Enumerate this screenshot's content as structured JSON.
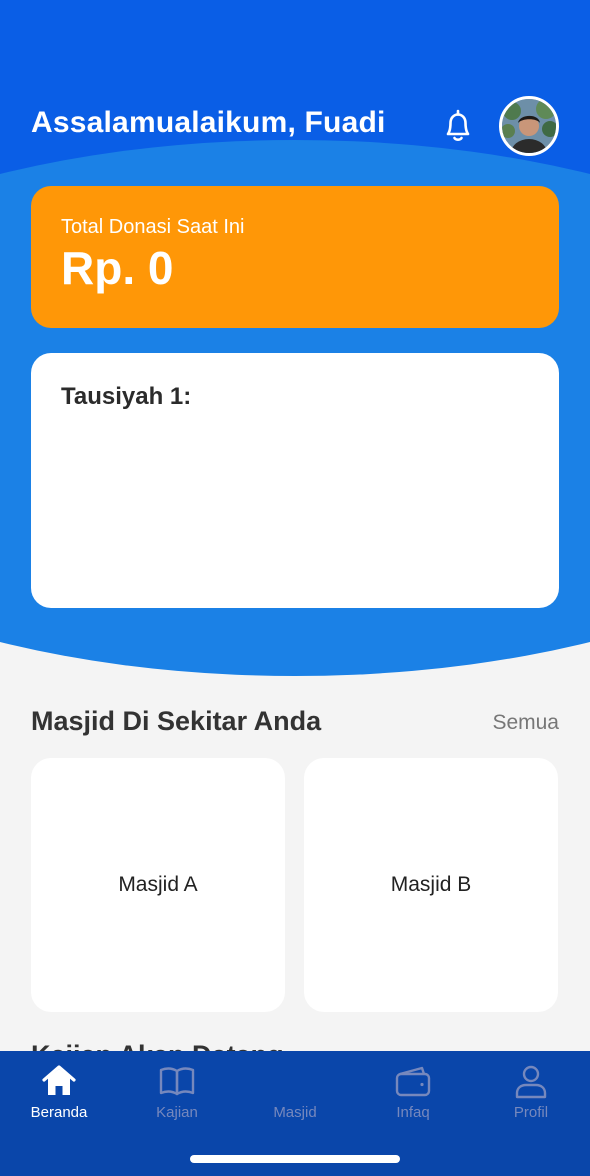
{
  "header": {
    "greeting": "Assalamualaikum, Fuadi",
    "notification_icon": "bell-icon",
    "avatar_icon": "user-avatar"
  },
  "donation": {
    "label": "Total Donasi Saat Ini",
    "value": "Rp. 0"
  },
  "tausiyah": {
    "title": "Tausiyah 1:"
  },
  "nearby": {
    "title": "Masjid Di Sekitar Anda",
    "see_all": "Semua",
    "items": [
      {
        "name": "Masjid A"
      },
      {
        "name": "Masjid B"
      }
    ]
  },
  "next_section": {
    "title": "Kajian Akan Datang"
  },
  "colors": {
    "primary_blue": "#0a5ee6",
    "secondary_blue": "#1b81e6",
    "accent_orange": "#ff9707",
    "nav_background": "#0a46aa",
    "nav_inactive": "#7688bd"
  },
  "bottom_nav": {
    "items": [
      {
        "label": "Beranda",
        "icon": "home-icon",
        "active": true
      },
      {
        "label": "Kajian",
        "icon": "book-icon",
        "active": false
      },
      {
        "label": "Masjid",
        "icon": "mosque-icon",
        "active": false
      },
      {
        "label": "Infaq",
        "icon": "wallet-icon",
        "active": false
      },
      {
        "label": "Profil",
        "icon": "profile-icon",
        "active": false
      }
    ]
  }
}
